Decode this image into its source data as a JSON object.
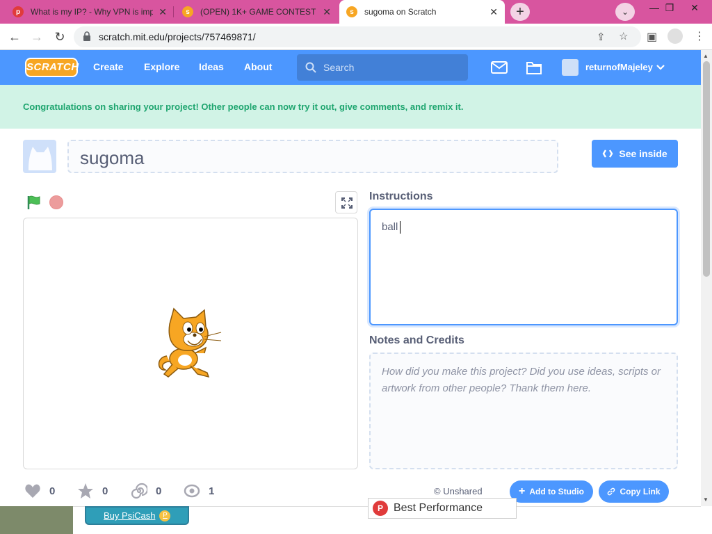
{
  "browser": {
    "tabs": [
      {
        "title": "What is my IP? - Why VPN is imp",
        "favicon": "p"
      },
      {
        "title": "(OPEN) 1K+ GAME CONTEST on",
        "favicon": "s"
      },
      {
        "title": "sugoma on Scratch",
        "favicon": "s",
        "active": true
      }
    ],
    "url": "scratch.mit.edu/projects/757469871/"
  },
  "nav": {
    "logo": "SCRATCH",
    "links": [
      "Create",
      "Explore",
      "Ideas",
      "About"
    ],
    "search_placeholder": "Search",
    "username": "returnofMajeley"
  },
  "banner": "Congratulations on sharing your project! Other people can now try it out, give comments, and remix it.",
  "project": {
    "title": "sugoma",
    "see_inside": "See inside",
    "instructions_label": "Instructions",
    "instructions_value": "ball",
    "notes_label": "Notes and Credits",
    "notes_placeholder": "How did you make this project? Did you use ideas, scripts or artwork from other people? Thank them here."
  },
  "stats": {
    "loves": "0",
    "favorites": "0",
    "remixes": "0",
    "views": "1"
  },
  "share": {
    "status": "Unshared",
    "add_to_studio": "Add to Studio",
    "copy_link": "Copy Link"
  },
  "overlay": {
    "buy": "Buy PsiCash",
    "coin": "P",
    "best": "Best Performance"
  },
  "colors": {
    "scratch_blue": "#4c97ff",
    "banner_green": "#1ea56f",
    "tab_strip": "#d8559f"
  }
}
